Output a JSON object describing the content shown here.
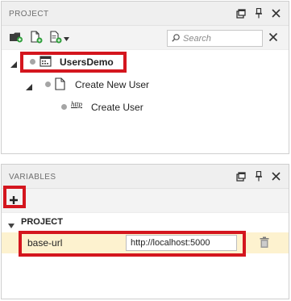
{
  "project_panel": {
    "title": "PROJECT",
    "search_placeholder": "Search",
    "tree": {
      "root": {
        "label": "UsersDemo"
      },
      "child": {
        "label": "Create New User"
      },
      "grandchild": {
        "label": "Create User",
        "icon_text": "http"
      }
    }
  },
  "variables_panel": {
    "title": "VARIABLES",
    "section_label": "PROJECT",
    "variables": [
      {
        "name": "base-url",
        "value": "http://localhost:5000"
      }
    ]
  },
  "colors": {
    "highlight": "#d4161e",
    "row_highlight": "#fdf2cf",
    "header_bg": "#efefef"
  },
  "icons": [
    "pin-window-icon",
    "pin-icon",
    "close-icon",
    "add-folder-icon",
    "new-file-icon",
    "new-test-dropdown-icon",
    "search-icon",
    "delete-icon"
  ]
}
